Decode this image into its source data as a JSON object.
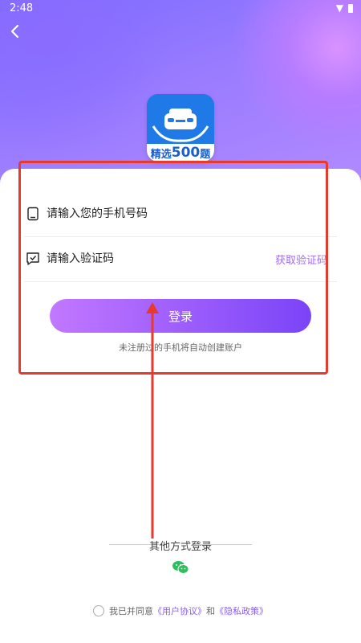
{
  "status_bar": {
    "time": "2:48",
    "wifi_icon": "wifi-icon",
    "battery_icon": "battery-icon"
  },
  "header": {
    "back_icon": "chevron-left-icon"
  },
  "logo": {
    "prefix": "精选",
    "number": "500",
    "suffix": "题"
  },
  "form": {
    "phone_placeholder": "请输入您的手机号码",
    "code_placeholder": "请输入验证码",
    "get_code_label": "获取验证码",
    "login_label": "登录",
    "hint": "未注册过的手机将自动创建账户"
  },
  "other_login": {
    "title": "其他方式登录",
    "wechat_icon": "wechat-icon"
  },
  "agreement": {
    "prefix": "我已并同意",
    "user_agreement": "《用户协议》",
    "conjunction": "和",
    "privacy_policy": "《隐私政策》"
  },
  "colors": {
    "accent": "#a46bf2",
    "button_start": "#c278ff",
    "button_end": "#7a44f7",
    "annotation": "#e53a2c"
  }
}
